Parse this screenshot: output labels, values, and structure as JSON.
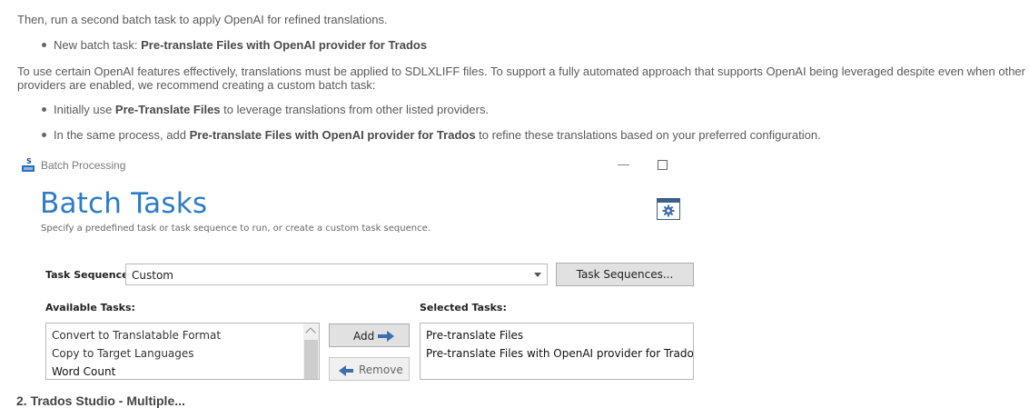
{
  "doc": {
    "line1": "Then, run a second batch task to apply OpenAI for refined translations.",
    "bullet1_prefix": "New batch task: ",
    "bullet1_bold": "Pre-translate Files with OpenAI provider for Trados",
    "para2_line1": "To use certain OpenAI features effectively, translations must be applied to SDLXLIFF files. To support a fully automated approach that supports OpenAI being leveraged despite even when other",
    "para2_line2": "providers are enabled, we recommend creating a custom batch task:",
    "bullet2_prefix": "Initially use ",
    "bullet2_bold": "Pre-Translate Files",
    "bullet2_suffix": " to leverage translations from other listed providers.",
    "bullet3_prefix": "In the same process, add ",
    "bullet3_bold": "Pre-translate Files with OpenAI provider for Trados",
    "bullet3_suffix": " to refine these translations based on your preferred configuration.",
    "next_heading": "2. Trados Studio - Multiple..."
  },
  "window": {
    "title": "Batch Processing",
    "icon_text": "S",
    "minimize_glyph": "—",
    "heading": "Batch Tasks",
    "subtitle": "Specify a predefined task or task sequence to run, or create a custom task sequence."
  },
  "form": {
    "task_sequence_label": "Task Sequence:",
    "task_sequence_value": "Custom",
    "task_sequences_button": "Task Sequences...",
    "available_label": "Available Tasks:",
    "selected_label": "Selected Tasks:",
    "available_tasks": [
      "Convert to Translatable Format",
      "Copy to Target Languages",
      "Word Count"
    ],
    "selected_tasks": [
      "Pre-translate Files",
      "Pre-translate Files with OpenAI provider for Trados"
    ],
    "add_button": "Add",
    "remove_button": "Remove"
  },
  "colors": {
    "accent": "#2e7bc6",
    "button_bg": "#e1e1e1"
  }
}
